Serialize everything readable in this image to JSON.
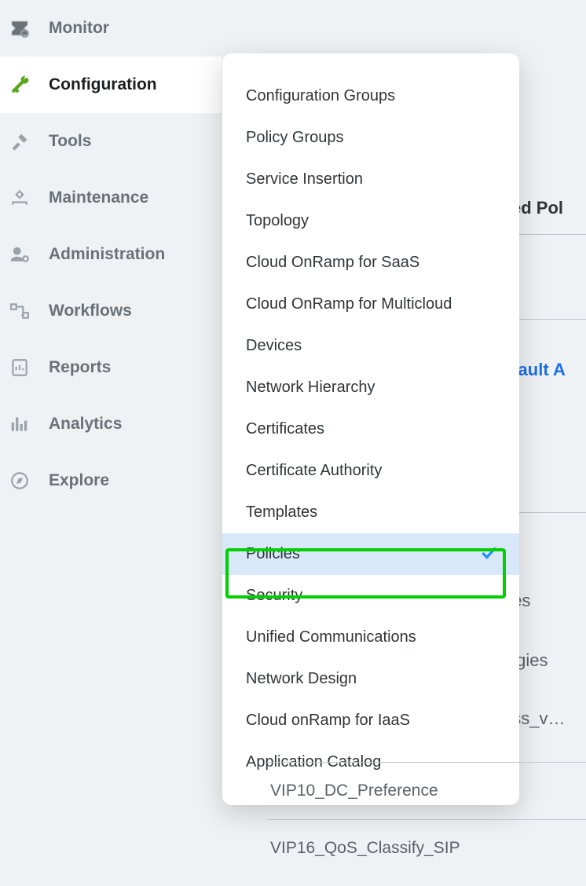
{
  "sidebar": {
    "items": [
      {
        "label": "Monitor"
      },
      {
        "label": "Configuration"
      },
      {
        "label": "Tools"
      },
      {
        "label": "Maintenance"
      },
      {
        "label": "Administration"
      },
      {
        "label": "Workflows"
      },
      {
        "label": "Reports"
      },
      {
        "label": "Analytics"
      },
      {
        "label": "Explore"
      }
    ],
    "active_index": 1
  },
  "dropdown": {
    "items": [
      {
        "label": "Configuration Groups"
      },
      {
        "label": "Policy Groups"
      },
      {
        "label": "Service Insertion"
      },
      {
        "label": "Topology"
      },
      {
        "label": "Cloud OnRamp for SaaS"
      },
      {
        "label": "Cloud OnRamp for Multicloud"
      },
      {
        "label": "Devices"
      },
      {
        "label": "Network Hierarchy"
      },
      {
        "label": "Certificates"
      },
      {
        "label": "Certificate Authority"
      },
      {
        "label": "Templates"
      },
      {
        "label": "Policies"
      },
      {
        "label": "Security"
      },
      {
        "label": "Unified Communications"
      },
      {
        "label": "Network Design"
      },
      {
        "label": "Cloud onRamp for IaaS"
      },
      {
        "label": "Application Catalog"
      }
    ],
    "selected_index": 11
  },
  "peek": {
    "tab_fragment": "zed Pol",
    "link_fragment": "efault A",
    "fragment_1": "nes",
    "fragment_2": "logies",
    "fragment_3": "ess_v…"
  },
  "policy_rows": {
    "r1": "VIP10_DC_Preference",
    "r2": "VIP16_QoS_Classify_SIP"
  }
}
